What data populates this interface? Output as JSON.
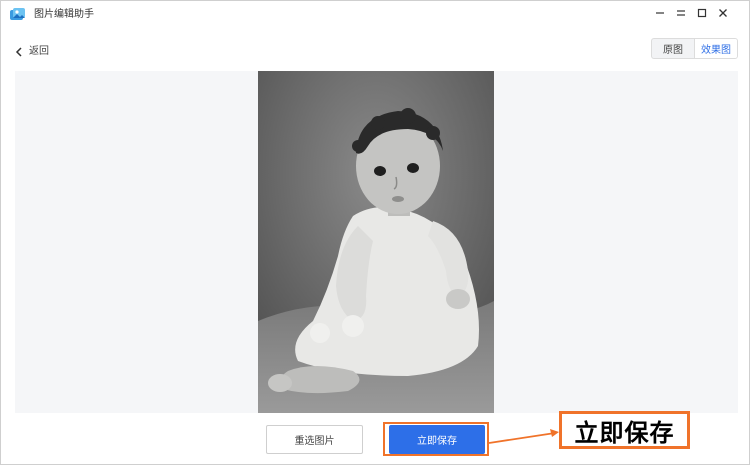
{
  "window": {
    "title": "图片编辑助手",
    "controls": [
      "minimize-icon",
      "restore-icon",
      "maximize-icon",
      "close-icon"
    ]
  },
  "header": {
    "back_label": "返回",
    "view_toggle": {
      "options": [
        "原图",
        "效果图"
      ],
      "selected": "效果图"
    }
  },
  "preview": {
    "image": "black-and-white portrait photo of a toddler in a white knitted dress"
  },
  "footer": {
    "reselect_label": "重选图片",
    "save_label": "立即保存"
  },
  "annotation": {
    "label": "立即保存"
  },
  "colors": {
    "accent": "#2d6fe8",
    "annotation": "#f0732a",
    "preview_bg": "#f5f6f8"
  }
}
